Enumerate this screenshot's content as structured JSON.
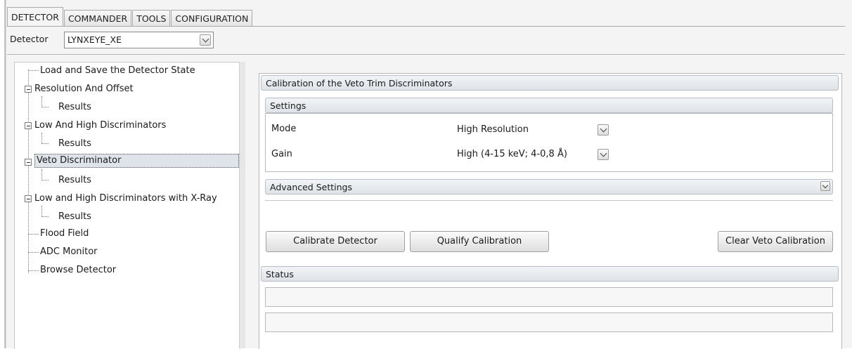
{
  "tabs": [
    {
      "label": "DETECTOR",
      "active": true
    },
    {
      "label": "COMMANDER",
      "active": false
    },
    {
      "label": "TOOLS",
      "active": false
    },
    {
      "label": "CONFIGURATION",
      "active": false
    }
  ],
  "detector": {
    "label": "Detector",
    "value": "LYNXEYE_XE"
  },
  "tree": {
    "items": [
      {
        "label": "Load and Save the Detector State"
      },
      {
        "label": "Resolution And Offset",
        "expanded": true
      },
      {
        "label": "Results"
      },
      {
        "label": "Low And High Discriminators",
        "expanded": true
      },
      {
        "label": "Results"
      },
      {
        "label": "Veto Discriminator",
        "expanded": true,
        "selected": true
      },
      {
        "label": "Results"
      },
      {
        "label": "Low and High Discriminators with X-Ray",
        "expanded": true
      },
      {
        "label": "Results"
      },
      {
        "label": "Flood Field"
      },
      {
        "label": "ADC Monitor"
      },
      {
        "label": "Browse Detector"
      }
    ]
  },
  "calibration": {
    "title": "Calibration of the Veto Trim Discriminators",
    "settings_header": "Settings",
    "mode_label": "Mode",
    "mode_value": "High Resolution",
    "gain_label": "Gain",
    "gain_value": "High (4-15 keV; 4-0,8 Å)",
    "advanced_header": "Advanced Settings",
    "buttons": {
      "calibrate": "Calibrate Detector",
      "qualify": "Qualify Calibration",
      "clear": "Clear Veto Calibration"
    }
  },
  "status": {
    "header": "Status"
  }
}
